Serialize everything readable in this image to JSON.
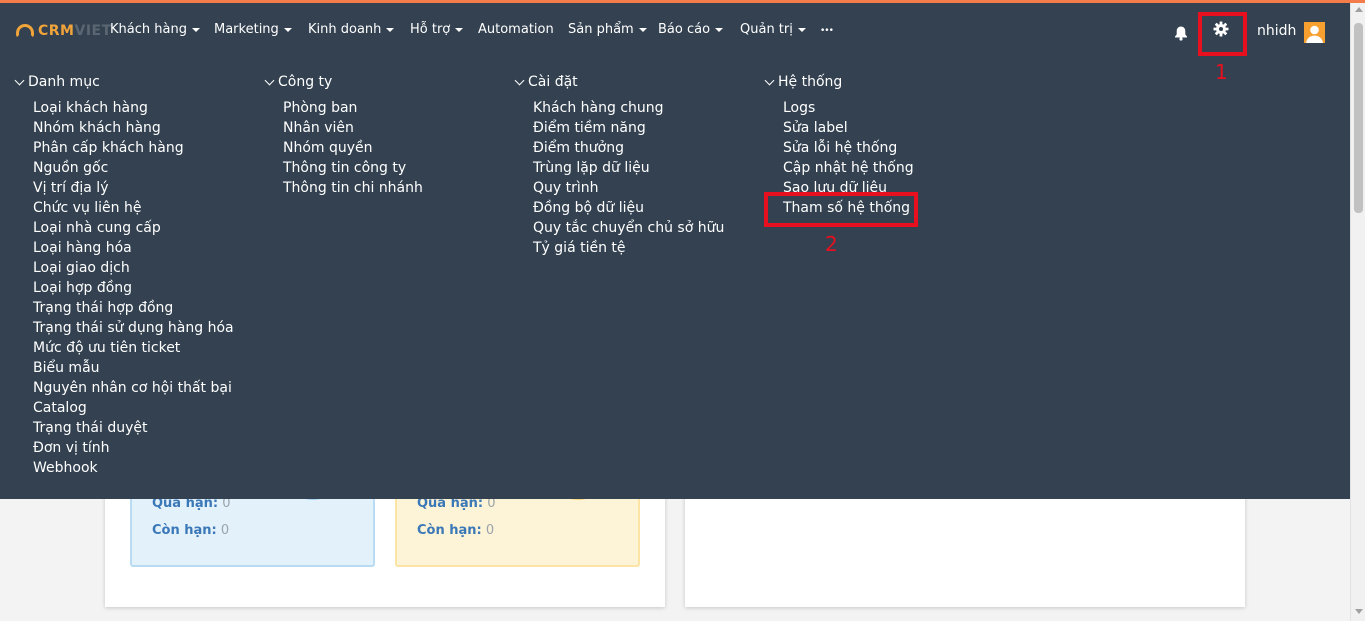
{
  "brand": {
    "logo_main": "CRM",
    "logo_dim": "VIET"
  },
  "nav": {
    "items": [
      {
        "label": "Khách hàng",
        "caret": true
      },
      {
        "label": "Marketing",
        "caret": true
      },
      {
        "label": "Kinh doanh",
        "caret": true
      },
      {
        "label": "Hỗ trợ",
        "caret": true
      },
      {
        "label": "Automation",
        "caret": false
      },
      {
        "label": "Sản phẩm",
        "caret": true
      },
      {
        "label": "Báo cáo",
        "caret": true
      },
      {
        "label": "Quản trị",
        "caret": true
      },
      {
        "label": "•••",
        "caret": false
      }
    ],
    "bell_icon": "bell-icon",
    "gear_icon": "gear-icon",
    "user_name": "nhidh"
  },
  "mega_menu": {
    "columns": [
      {
        "heading": "Danh mục",
        "items": [
          "Loại khách hàng",
          "Nhóm khách hàng",
          "Phân cấp khách hàng",
          "Nguồn gốc",
          "Vị trí địa lý",
          "Chức vụ liên hệ",
          "Loại nhà cung cấp",
          "Loại hàng hóa",
          "Loại giao dịch",
          "Loại hợp đồng",
          "Trạng thái hợp đồng",
          "Trạng thái sử dụng hàng hóa",
          "Mức độ ưu tiên ticket",
          "Biểu mẫu",
          "Nguyên nhân cơ hội thất bại",
          "Catalog",
          "Trạng thái duyệt",
          "Đơn vị tính",
          "Webhook"
        ]
      },
      {
        "heading": "Công ty",
        "items": [
          "Phòng ban",
          "Nhân viên",
          "Nhóm quyền",
          "Thông tin công ty",
          "Thông tin chi nhánh"
        ]
      },
      {
        "heading": "Cài đặt",
        "items": [
          "Khách hàng chung",
          "Điểm tiềm năng",
          "Điểm thưởng",
          "Trùng lặp dữ liệu",
          "Quy trình",
          "Đồng bộ dữ liệu",
          "Quy tắc chuyển chủ sở hữu",
          "Tỷ giá tiền tệ"
        ]
      },
      {
        "heading": "Hệ thống",
        "items": [
          "Logs",
          "Sửa label",
          "Sửa lỗi hệ thống",
          "Cập nhật hệ thống",
          "Sao lưu dữ liệu",
          "Tham số hệ thống"
        ]
      }
    ]
  },
  "annotations": {
    "marker_1": "1",
    "marker_2": "2",
    "color": "#e8101e"
  },
  "cards": {
    "blue": {
      "overdue_label": "Quá hạn:",
      "overdue_value": "0",
      "remaining_label": "Còn hạn:",
      "remaining_value": "0"
    },
    "yellow": {
      "overdue_label": "Quá hạn:",
      "overdue_value": "0",
      "remaining_label": "Còn hạn:",
      "remaining_value": "0"
    }
  },
  "colors": {
    "navbar": "#334150",
    "accent_stripe": "#f47c4b",
    "brand_orange": "#f0a43a",
    "highlight_red": "#e8101e"
  }
}
